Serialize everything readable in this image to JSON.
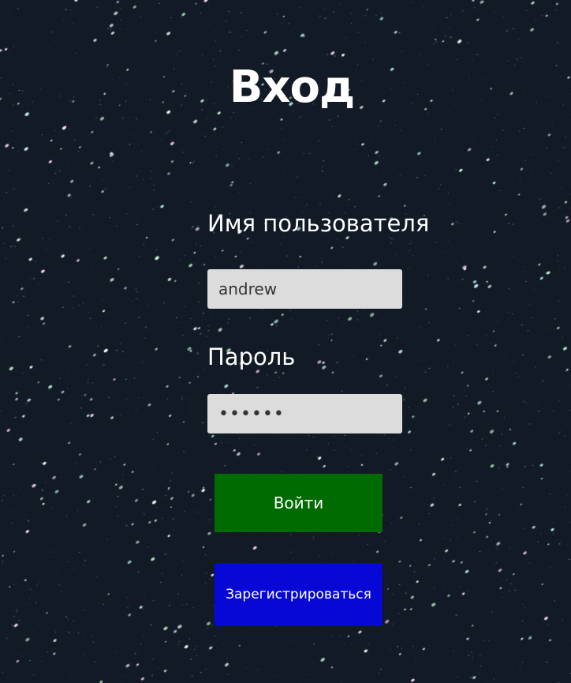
{
  "page": {
    "title": "Вход",
    "background_color": "#121a26"
  },
  "form": {
    "username_label": "Имя пользователя",
    "username_value": "andrew",
    "password_label": "Пароль",
    "password_value": "••••••",
    "login_button": "Войти",
    "register_button": "Зарегистрироваться"
  },
  "colors": {
    "login_button": "#006b00",
    "register_button": "#0808d6",
    "input_background": "#dcdcdc"
  }
}
